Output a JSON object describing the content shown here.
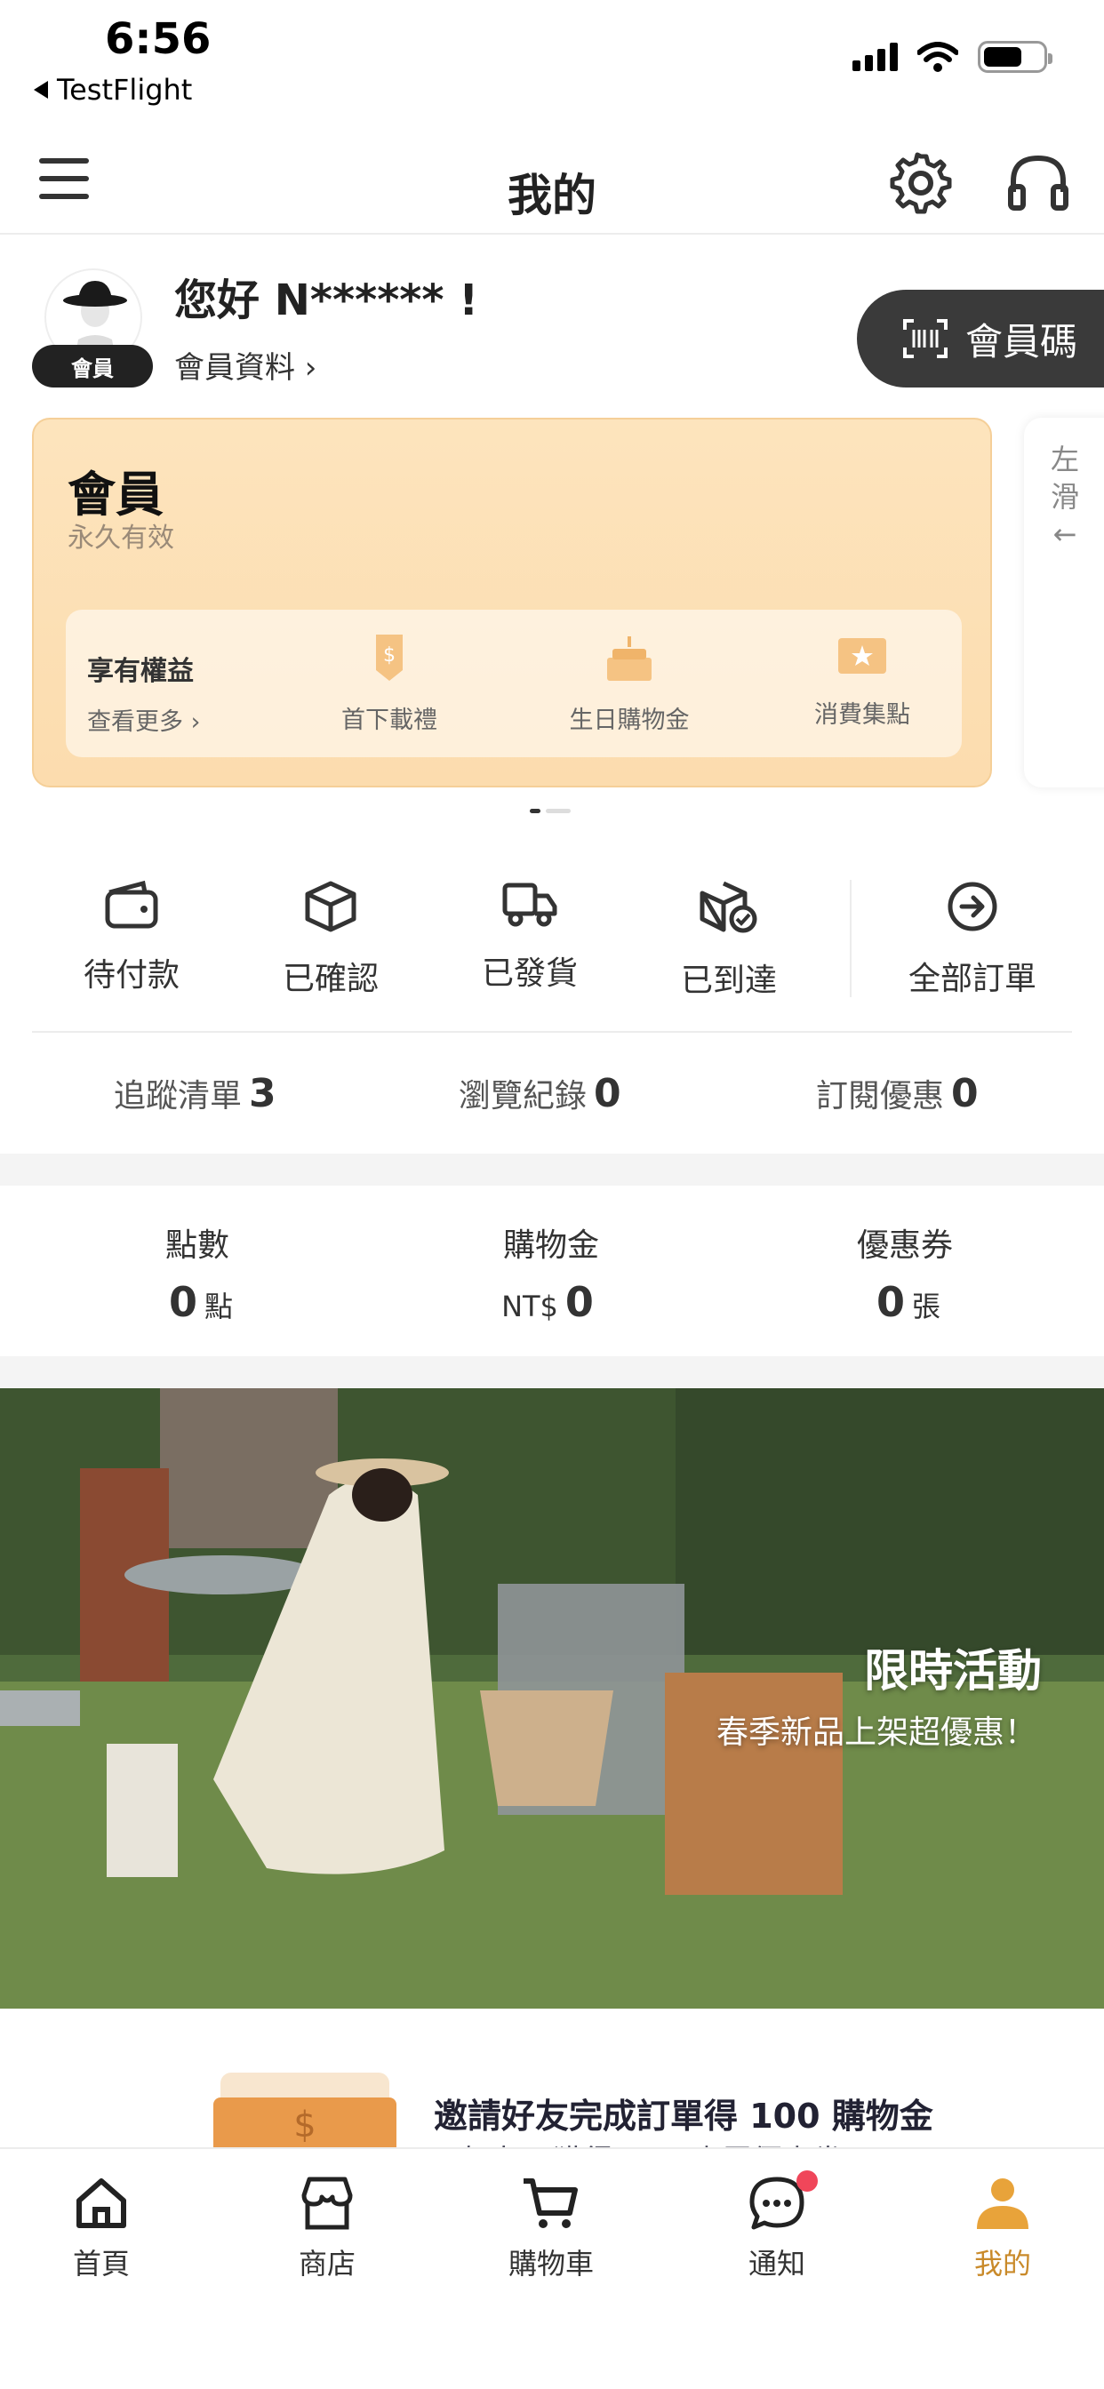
{
  "status_bar": {
    "time": "6:56",
    "back_app": "TestFlight"
  },
  "nav": {
    "title": "我的"
  },
  "profile": {
    "greeting": "您好 N****** !",
    "member_badge": "會員",
    "member_info": "會員資料 ›",
    "member_code_button": "會員碼"
  },
  "member_card": {
    "level": "會員",
    "validity": "永久有效",
    "benefits_title": "享有權益",
    "benefits_more": "查看更多 ›",
    "benefits": [
      {
        "label": "首下載禮",
        "icon": "dollar-badge-icon"
      },
      {
        "label": "生日購物金",
        "icon": "birthday-cake-icon"
      },
      {
        "label": "消費集點",
        "icon": "star-ticket-icon"
      }
    ],
    "swipe_hint": "左滑←"
  },
  "orders": [
    {
      "label": "待付款",
      "icon": "wallet-icon"
    },
    {
      "label": "已確認",
      "icon": "box-icon"
    },
    {
      "label": "已發貨",
      "icon": "truck-icon"
    },
    {
      "label": "已到達",
      "icon": "box-check-icon"
    },
    {
      "label": "全部訂單",
      "icon": "arrow-circle-icon"
    }
  ],
  "stats": [
    {
      "label": "追蹤清單",
      "value": "3"
    },
    {
      "label": "瀏覽紀錄",
      "value": "0"
    },
    {
      "label": "訂閱優惠",
      "value": "0"
    }
  ],
  "wallet": [
    {
      "title": "點數",
      "prefix": "",
      "value": "0",
      "unit": "點"
    },
    {
      "title": "購物金",
      "prefix": "NT$",
      "value": "0",
      "unit": ""
    },
    {
      "title": "優惠券",
      "prefix": "",
      "value": "0",
      "unit": "張"
    }
  ],
  "banner": {
    "title": "限時活動",
    "subtitle": "春季新品上架超優惠！"
  },
  "invite": {
    "title": "邀請好友完成訂單得 100 購物金",
    "subtitle": "好友可獲得 App 專屬優惠券"
  },
  "tabbar": [
    {
      "label": "首頁",
      "icon": "home-icon"
    },
    {
      "label": "商店",
      "icon": "store-icon"
    },
    {
      "label": "購物車",
      "icon": "cart-icon"
    },
    {
      "label": "通知",
      "icon": "chat-bubble-icon"
    },
    {
      "label": "我的",
      "icon": "user-icon"
    }
  ],
  "colors": {
    "accent": "#e8a33a",
    "card": "#fde4bd",
    "dark_button": "#3a3a3a",
    "notif": "#f0465a"
  }
}
